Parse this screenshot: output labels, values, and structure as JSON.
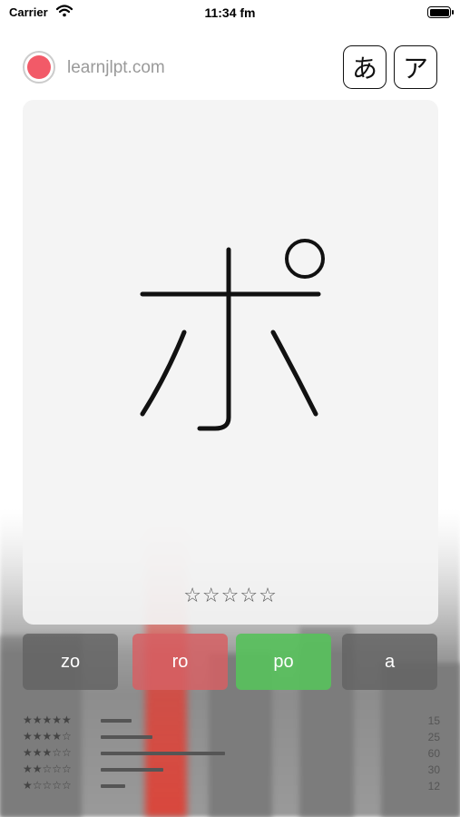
{
  "status_bar": {
    "carrier": "Carrier",
    "time": "11:34 fm",
    "wifi_icon": "wifi-icon",
    "battery_icon": "battery-icon"
  },
  "header": {
    "site": "learnjlpt.com",
    "record_color": "#f25a68",
    "hiragana_label": "あ",
    "katakana_label": "ア"
  },
  "card": {
    "character": "ポ",
    "stars": "☆☆☆☆☆",
    "rating": 0
  },
  "answers": [
    {
      "label": "zo",
      "state": "neutral",
      "color": "#646464"
    },
    {
      "label": "ro",
      "state": "wrong",
      "color": "#d66064"
    },
    {
      "label": "po",
      "state": "correct",
      "color": "#58c05c"
    },
    {
      "label": "a",
      "state": "neutral",
      "color": "#646464"
    }
  ],
  "stats": [
    {
      "stars": "★★★★★",
      "count": "15",
      "value": 15
    },
    {
      "stars": "★★★★☆",
      "count": "25",
      "value": 25
    },
    {
      "stars": "★★★☆☆",
      "count": "60",
      "value": 60
    },
    {
      "stars": "★★☆☆☆",
      "count": "30",
      "value": 30
    },
    {
      "stars": "★☆☆☆☆",
      "count": "12",
      "value": 12
    }
  ]
}
